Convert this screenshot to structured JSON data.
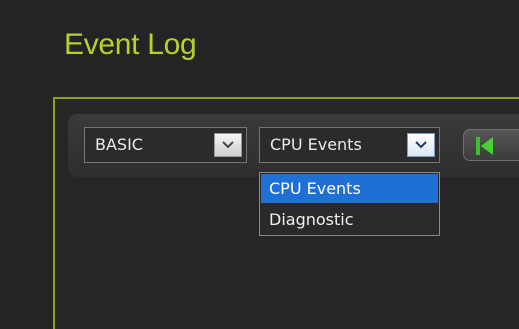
{
  "header": {
    "title": "Event Log"
  },
  "toolbar": {
    "level_select": {
      "value": "BASIC"
    },
    "category_select": {
      "value": "CPU Events"
    },
    "nav_first_icon": "skip-to-first-icon",
    "nav_next_glyph_partial": "▌"
  },
  "category_dropdown": {
    "options": [
      {
        "label": "CPU Events",
        "selected": true
      },
      {
        "label": "Diagnostic",
        "selected": false
      }
    ]
  },
  "colors": {
    "accent": "#b9cf2e",
    "panel_border": "#8ca21a",
    "selection": "#1e6fd6",
    "background": "#242424"
  }
}
